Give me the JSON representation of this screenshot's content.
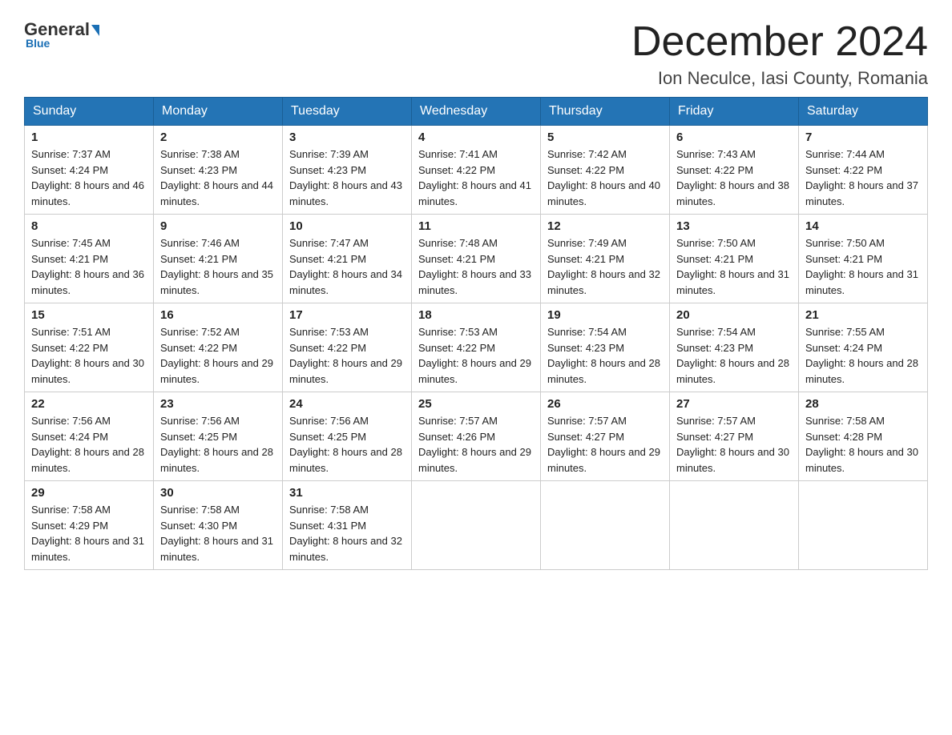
{
  "logo": {
    "general": "General",
    "blue": "Blue"
  },
  "header": {
    "title": "December 2024",
    "subtitle": "Ion Neculce, Iasi County, Romania"
  },
  "weekdays": [
    "Sunday",
    "Monday",
    "Tuesday",
    "Wednesday",
    "Thursday",
    "Friday",
    "Saturday"
  ],
  "weeks": [
    [
      {
        "day": "1",
        "sunrise": "7:37 AM",
        "sunset": "4:24 PM",
        "daylight": "8 hours and 46 minutes."
      },
      {
        "day": "2",
        "sunrise": "7:38 AM",
        "sunset": "4:23 PM",
        "daylight": "8 hours and 44 minutes."
      },
      {
        "day": "3",
        "sunrise": "7:39 AM",
        "sunset": "4:23 PM",
        "daylight": "8 hours and 43 minutes."
      },
      {
        "day": "4",
        "sunrise": "7:41 AM",
        "sunset": "4:22 PM",
        "daylight": "8 hours and 41 minutes."
      },
      {
        "day": "5",
        "sunrise": "7:42 AM",
        "sunset": "4:22 PM",
        "daylight": "8 hours and 40 minutes."
      },
      {
        "day": "6",
        "sunrise": "7:43 AM",
        "sunset": "4:22 PM",
        "daylight": "8 hours and 38 minutes."
      },
      {
        "day": "7",
        "sunrise": "7:44 AM",
        "sunset": "4:22 PM",
        "daylight": "8 hours and 37 minutes."
      }
    ],
    [
      {
        "day": "8",
        "sunrise": "7:45 AM",
        "sunset": "4:21 PM",
        "daylight": "8 hours and 36 minutes."
      },
      {
        "day": "9",
        "sunrise": "7:46 AM",
        "sunset": "4:21 PM",
        "daylight": "8 hours and 35 minutes."
      },
      {
        "day": "10",
        "sunrise": "7:47 AM",
        "sunset": "4:21 PM",
        "daylight": "8 hours and 34 minutes."
      },
      {
        "day": "11",
        "sunrise": "7:48 AM",
        "sunset": "4:21 PM",
        "daylight": "8 hours and 33 minutes."
      },
      {
        "day": "12",
        "sunrise": "7:49 AM",
        "sunset": "4:21 PM",
        "daylight": "8 hours and 32 minutes."
      },
      {
        "day": "13",
        "sunrise": "7:50 AM",
        "sunset": "4:21 PM",
        "daylight": "8 hours and 31 minutes."
      },
      {
        "day": "14",
        "sunrise": "7:50 AM",
        "sunset": "4:21 PM",
        "daylight": "8 hours and 31 minutes."
      }
    ],
    [
      {
        "day": "15",
        "sunrise": "7:51 AM",
        "sunset": "4:22 PM",
        "daylight": "8 hours and 30 minutes."
      },
      {
        "day": "16",
        "sunrise": "7:52 AM",
        "sunset": "4:22 PM",
        "daylight": "8 hours and 29 minutes."
      },
      {
        "day": "17",
        "sunrise": "7:53 AM",
        "sunset": "4:22 PM",
        "daylight": "8 hours and 29 minutes."
      },
      {
        "day": "18",
        "sunrise": "7:53 AM",
        "sunset": "4:22 PM",
        "daylight": "8 hours and 29 minutes."
      },
      {
        "day": "19",
        "sunrise": "7:54 AM",
        "sunset": "4:23 PM",
        "daylight": "8 hours and 28 minutes."
      },
      {
        "day": "20",
        "sunrise": "7:54 AM",
        "sunset": "4:23 PM",
        "daylight": "8 hours and 28 minutes."
      },
      {
        "day": "21",
        "sunrise": "7:55 AM",
        "sunset": "4:24 PM",
        "daylight": "8 hours and 28 minutes."
      }
    ],
    [
      {
        "day": "22",
        "sunrise": "7:56 AM",
        "sunset": "4:24 PM",
        "daylight": "8 hours and 28 minutes."
      },
      {
        "day": "23",
        "sunrise": "7:56 AM",
        "sunset": "4:25 PM",
        "daylight": "8 hours and 28 minutes."
      },
      {
        "day": "24",
        "sunrise": "7:56 AM",
        "sunset": "4:25 PM",
        "daylight": "8 hours and 28 minutes."
      },
      {
        "day": "25",
        "sunrise": "7:57 AM",
        "sunset": "4:26 PM",
        "daylight": "8 hours and 29 minutes."
      },
      {
        "day": "26",
        "sunrise": "7:57 AM",
        "sunset": "4:27 PM",
        "daylight": "8 hours and 29 minutes."
      },
      {
        "day": "27",
        "sunrise": "7:57 AM",
        "sunset": "4:27 PM",
        "daylight": "8 hours and 30 minutes."
      },
      {
        "day": "28",
        "sunrise": "7:58 AM",
        "sunset": "4:28 PM",
        "daylight": "8 hours and 30 minutes."
      }
    ],
    [
      {
        "day": "29",
        "sunrise": "7:58 AM",
        "sunset": "4:29 PM",
        "daylight": "8 hours and 31 minutes."
      },
      {
        "day": "30",
        "sunrise": "7:58 AM",
        "sunset": "4:30 PM",
        "daylight": "8 hours and 31 minutes."
      },
      {
        "day": "31",
        "sunrise": "7:58 AM",
        "sunset": "4:31 PM",
        "daylight": "8 hours and 32 minutes."
      },
      null,
      null,
      null,
      null
    ]
  ]
}
